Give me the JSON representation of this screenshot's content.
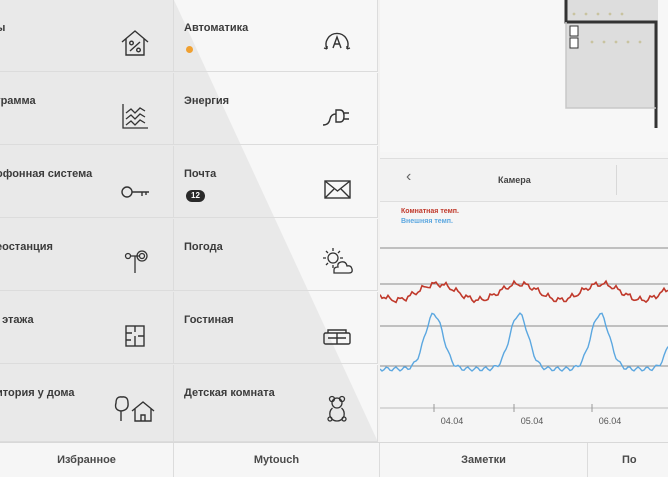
{
  "tiles": [
    {
      "label": "ы",
      "icon": "house-percent-icon"
    },
    {
      "label": "Автоматика",
      "icon": "automation-a-icon",
      "indicator_color": "#f0a030"
    },
    {
      "label": "грамма",
      "icon": "chart-program-icon"
    },
    {
      "label": "Энергия",
      "icon": "plug-energy-icon"
    },
    {
      "label": "офонная система",
      "icon": "door-key-icon"
    },
    {
      "label": "Почта",
      "icon": "envelope-icon",
      "badge": "12"
    },
    {
      "label": "еостанция",
      "icon": "weather-station-icon"
    },
    {
      "label": "Погода",
      "icon": "sun-cloud-icon"
    },
    {
      "label": "і этажа",
      "icon": "floor-plan-icon"
    },
    {
      "label": "Гостиная",
      "icon": "sofa-icon"
    },
    {
      "label": "итория у дома",
      "icon": "garden-house-icon"
    },
    {
      "label": "Детская комната",
      "icon": "teddy-bear-icon"
    }
  ],
  "camera": {
    "title": "Камера",
    "back_icon": "chevron-left-icon"
  },
  "chart_data": {
    "type": "line",
    "title": "",
    "xlabel": "",
    "ylabel": "",
    "x_ticks": [
      "04.04",
      "05.04",
      "06.04"
    ],
    "series": [
      {
        "name": "Комнатная темп.",
        "color": "#c0392b"
      },
      {
        "name": "Внешняя темп.",
        "color": "#5ba7e0"
      }
    ],
    "grid": true,
    "legend": "top-left"
  },
  "tabs": [
    "Избранное",
    "Mytouch",
    "Заметки",
    "По"
  ],
  "colors": {
    "accent_orange": "#f0a030",
    "room_temp": "#c0392b",
    "outside_temp": "#5ba7e0"
  }
}
